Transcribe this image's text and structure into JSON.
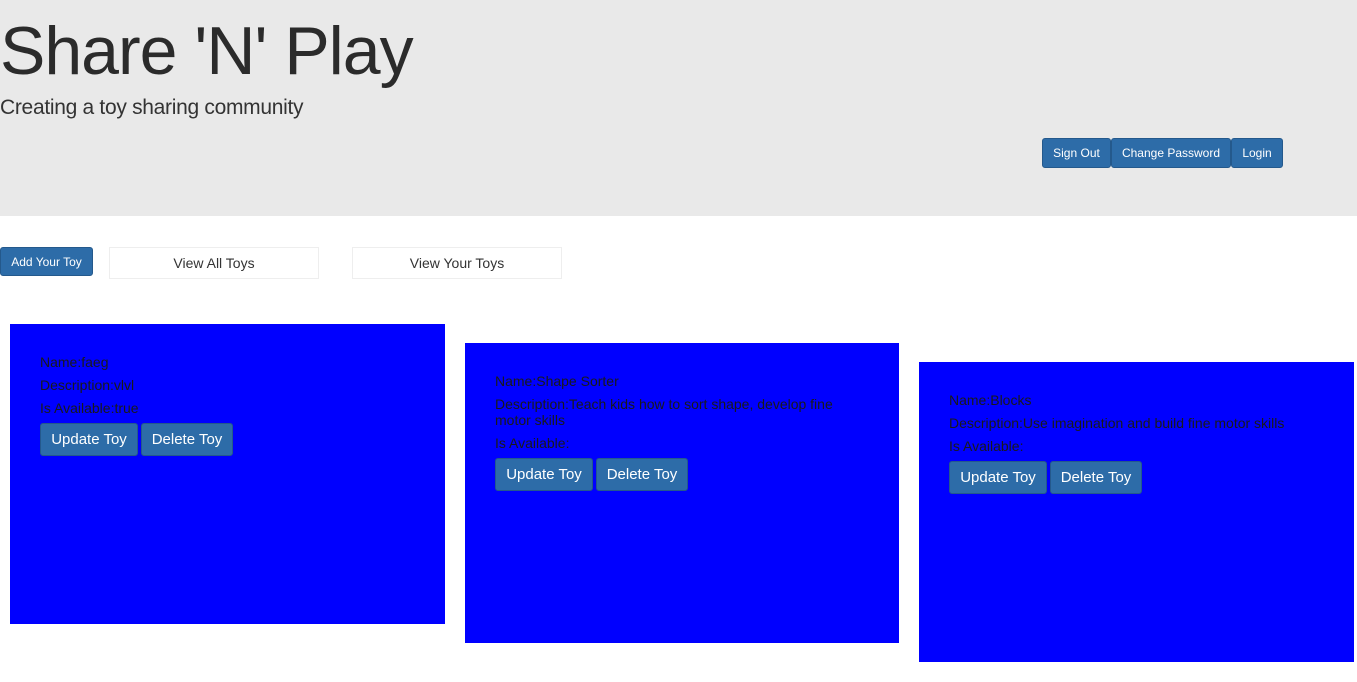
{
  "header": {
    "title": "Share 'N' Play",
    "subtitle": "Creating a toy sharing community",
    "auth_buttons": {
      "sign_out": "Sign Out",
      "change_password": "Change Password",
      "login": "Login"
    }
  },
  "nav": {
    "add_toy": "Add Your Toy",
    "view_all": "View All Toys",
    "view_yours": "View Your Toys"
  },
  "toys": [
    {
      "name": "Name:faeg",
      "description": "Description:vlvl",
      "available": "Is Available:true",
      "update_label": "Update Toy",
      "delete_label": "Delete Toy"
    },
    {
      "name": "Name:Shape Sorter",
      "description": "Description:Teach kids how to sort shape, develop fine motor skills",
      "available": "Is Available:",
      "update_label": "Update Toy",
      "delete_label": "Delete Toy"
    },
    {
      "name": "Name:Blocks",
      "description": "Description:Use imagination and build fine motor skills",
      "available": "Is Available:",
      "update_label": "Update Toy",
      "delete_label": "Delete Toy"
    }
  ],
  "colors": {
    "header_bg": "#e9e9e9",
    "button_primary": "#2d6ca8",
    "card_bg": "#0000ff"
  }
}
